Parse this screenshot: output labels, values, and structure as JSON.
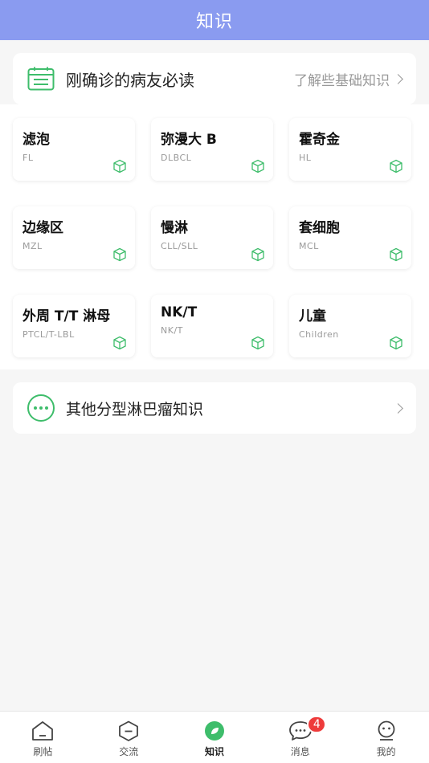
{
  "header": {
    "title": "知识"
  },
  "newbie": {
    "title": "刚确诊的病友必读",
    "subtitle": "了解些基础知识"
  },
  "types": [
    {
      "name": "滤泡",
      "abbr": "FL"
    },
    {
      "name": "弥漫大 B",
      "abbr": "DLBCL"
    },
    {
      "name": "霍奇金",
      "abbr": "HL"
    },
    {
      "name": "边缘区",
      "abbr": "MZL"
    },
    {
      "name": "慢淋",
      "abbr": "CLL/SLL"
    },
    {
      "name": "套细胞",
      "abbr": "MCL"
    },
    {
      "name": "外周 T/T 淋母",
      "abbr": "PTCL/T-LBL"
    },
    {
      "name": "NK/T",
      "abbr": "NK/T"
    },
    {
      "name": "儿童",
      "abbr": "Children"
    }
  ],
  "other": {
    "title": "其他分型淋巴瘤知识"
  },
  "tabs": [
    {
      "label": "刷帖",
      "icon": "home-icon"
    },
    {
      "label": "交流",
      "icon": "hexagon-minus-icon"
    },
    {
      "label": "知识",
      "icon": "knowledge-leaf-icon"
    },
    {
      "label": "消息",
      "icon": "chat-bubble-icon",
      "badge": "4"
    },
    {
      "label": "我的",
      "icon": "profile-face-icon"
    }
  ],
  "colors": {
    "header": "#8a9bf0",
    "accent_green": "#3ebd6b",
    "badge": "#ee3b3b"
  }
}
